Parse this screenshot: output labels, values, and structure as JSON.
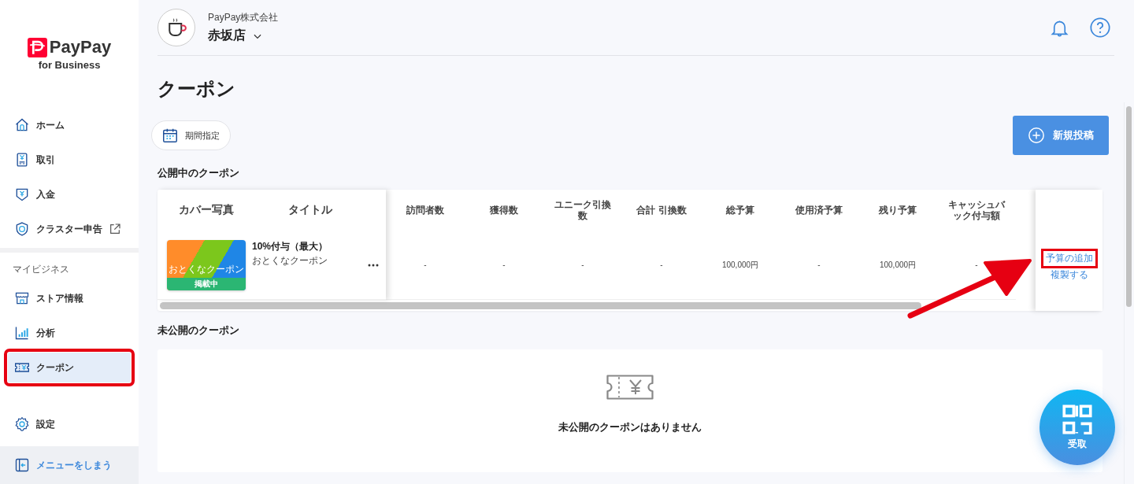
{
  "sidebar": {
    "logo": {
      "brand": "PayPay",
      "tagline": "for Business"
    },
    "main_items": [
      {
        "label": "ホーム",
        "selected": false,
        "highlighted": false,
        "external": false
      },
      {
        "label": "取引",
        "selected": false,
        "highlighted": false,
        "external": false
      },
      {
        "label": "入金",
        "selected": false,
        "highlighted": false,
        "external": false
      },
      {
        "label": "クラスター申告",
        "selected": false,
        "highlighted": false,
        "external": true
      }
    ],
    "section_label": "マイビジネス",
    "business_items": [
      {
        "label": "ストア情報",
        "selected": false,
        "highlighted": false,
        "external": false
      },
      {
        "label": "分析",
        "selected": false,
        "highlighted": false,
        "external": false
      },
      {
        "label": "クーポン",
        "selected": true,
        "highlighted": true,
        "external": false
      }
    ],
    "settings_items": [
      {
        "label": "設定",
        "selected": false,
        "highlighted": false,
        "external": false
      }
    ],
    "collapse_button": "メニューをしまう"
  },
  "header": {
    "company": "PayPay株式会社",
    "store": "赤坂店"
  },
  "page_title": "クーポン",
  "period_button": "期間指定",
  "new_post_button": "新規投稿",
  "published": {
    "heading": "公開中のクーポン",
    "fixed_columns": [
      "カバー写真",
      "タイトル"
    ],
    "columns": [
      "訪問者数",
      "獲得数",
      "ユニーク引換数",
      "合計 引換数",
      "総予算",
      "使用済予算",
      "残り予算",
      "キャッシュバック付与額"
    ],
    "rows": [
      {
        "cover_text": "おとくなクーポン",
        "status": "掲載中",
        "title": "10%付与（最大）",
        "subtitle": "おとくなクーポン",
        "cells": [
          "-",
          "-",
          "-",
          "-",
          "100,000円",
          "-",
          "100,000円",
          "-"
        ],
        "actions": [
          {
            "label": "予算の追加",
            "highlighted": true
          },
          {
            "label": "複製する",
            "highlighted": false
          }
        ]
      }
    ]
  },
  "unpublished": {
    "heading": "未公開のクーポン",
    "empty_message": "未公開のクーポンはありません"
  },
  "fab_label": "受取",
  "callout_arrow": true
}
